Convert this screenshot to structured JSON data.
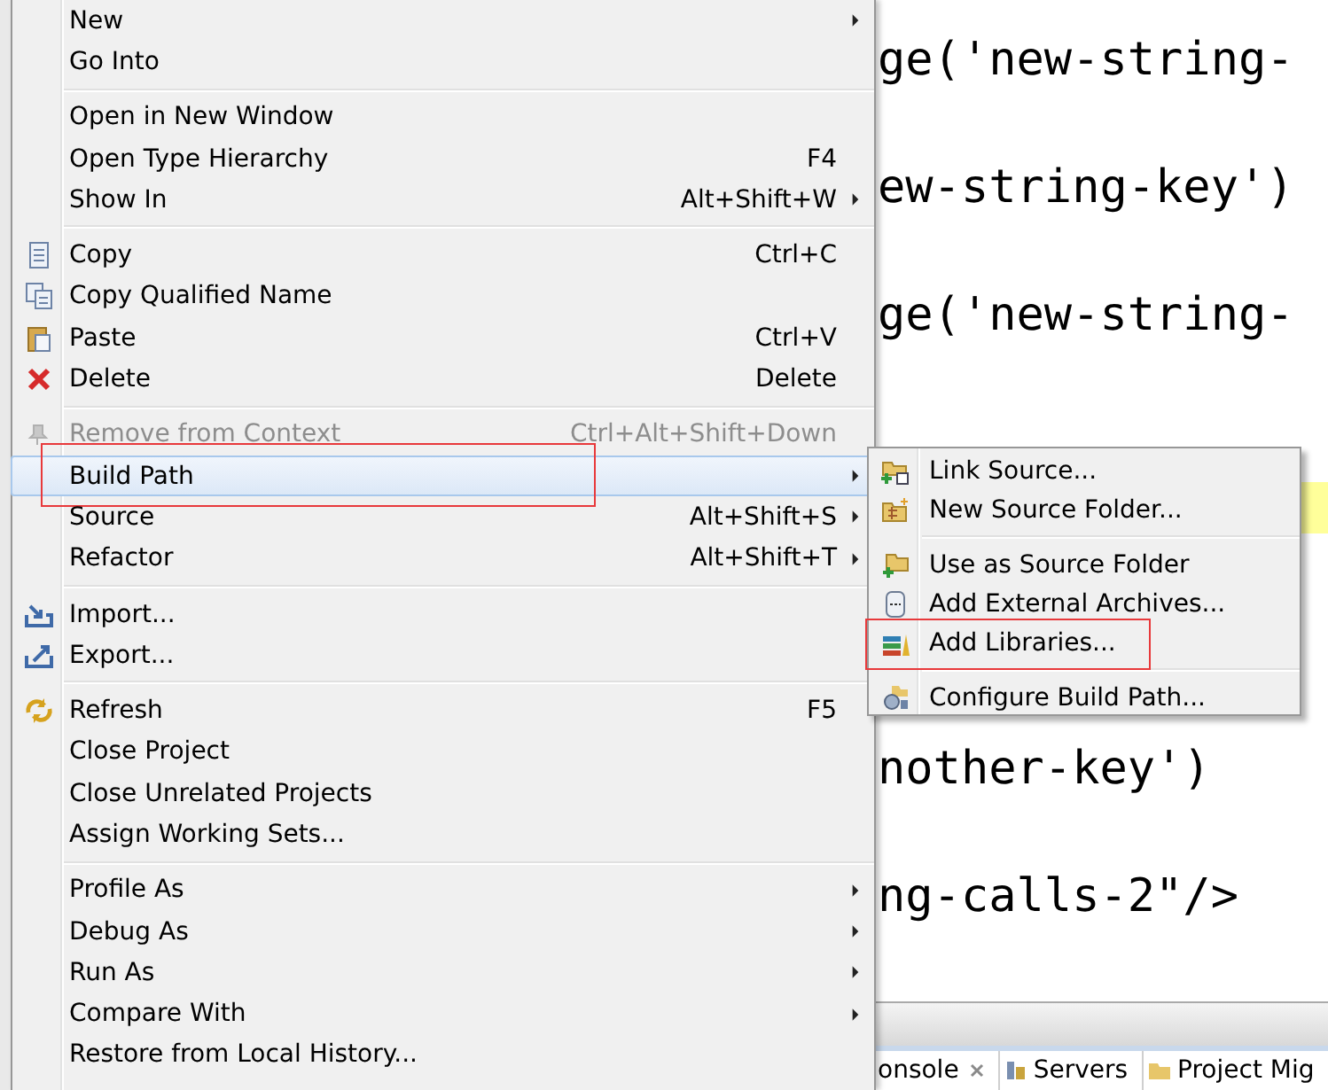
{
  "editor": {
    "code_lines": [
      {
        "text": "ge('new-string-"
      },
      {
        "text": "ew-string-key')"
      },
      {
        "text": "ge('new-string-"
      },
      {
        "text": "nother-key')"
      },
      {
        "text": "ng-calls-2\"/>"
      }
    ],
    "bottom_tabs": [
      {
        "label": "onsole",
        "closable": true
      },
      {
        "label": "Servers",
        "closable": false
      },
      {
        "label": "Project Mig",
        "closable": false
      }
    ]
  },
  "context_menu": {
    "groups": [
      [
        {
          "label": "New",
          "submenu": true,
          "disabled": false,
          "selected": false,
          "annotated": false
        },
        {
          "label": "Go Into",
          "submenu": false,
          "disabled": false,
          "selected": false,
          "annotated": false
        }
      ],
      [
        {
          "label": "Open in New Window",
          "submenu": false,
          "disabled": false,
          "selected": false,
          "annotated": false
        },
        {
          "label": "Open Type Hierarchy",
          "shortcut": "F4",
          "submenu": false,
          "disabled": false,
          "selected": false,
          "annotated": false
        },
        {
          "label": "Show In",
          "shortcut": "Alt+Shift+W",
          "submenu": true,
          "disabled": false,
          "selected": false,
          "annotated": false
        }
      ],
      [
        {
          "label": "Copy",
          "shortcut": "Ctrl+C",
          "submenu": false,
          "disabled": false,
          "selected": false,
          "annotated": false
        },
        {
          "label": "Copy Qualified Name",
          "submenu": false,
          "disabled": false,
          "selected": false,
          "annotated": false
        },
        {
          "label": "Paste",
          "shortcut": "Ctrl+V",
          "submenu": false,
          "disabled": false,
          "selected": false,
          "annotated": false
        },
        {
          "label": "Delete",
          "shortcut": "Delete",
          "submenu": false,
          "disabled": false,
          "selected": false,
          "annotated": false
        }
      ],
      [
        {
          "label": "Remove from Context",
          "shortcut": "Ctrl+Alt+Shift+Down",
          "submenu": false,
          "disabled": true,
          "selected": false,
          "annotated": false
        },
        {
          "label": "Build Path",
          "submenu": true,
          "disabled": false,
          "selected": true,
          "annotated": true
        },
        {
          "label": "Source",
          "shortcut": "Alt+Shift+S",
          "submenu": true,
          "disabled": false,
          "selected": false,
          "annotated": false
        },
        {
          "label": "Refactor",
          "shortcut": "Alt+Shift+T",
          "submenu": true,
          "disabled": false,
          "selected": false,
          "annotated": false
        }
      ],
      [
        {
          "label": "Import...",
          "submenu": false,
          "disabled": false,
          "selected": false,
          "annotated": false
        },
        {
          "label": "Export...",
          "submenu": false,
          "disabled": false,
          "selected": false,
          "annotated": false
        }
      ],
      [
        {
          "label": "Refresh",
          "shortcut": "F5",
          "submenu": false,
          "disabled": false,
          "selected": false,
          "annotated": false
        },
        {
          "label": "Close Project",
          "submenu": false,
          "disabled": false,
          "selected": false,
          "annotated": false
        },
        {
          "label": "Close Unrelated Projects",
          "submenu": false,
          "disabled": false,
          "selected": false,
          "annotated": false
        },
        {
          "label": "Assign Working Sets...",
          "submenu": false,
          "disabled": false,
          "selected": false,
          "annotated": false
        }
      ],
      [
        {
          "label": "Profile As",
          "submenu": true,
          "disabled": false,
          "selected": false,
          "annotated": false
        },
        {
          "label": "Debug As",
          "submenu": true,
          "disabled": false,
          "selected": false,
          "annotated": false
        },
        {
          "label": "Run As",
          "submenu": true,
          "disabled": false,
          "selected": false,
          "annotated": false
        },
        {
          "label": "Compare With",
          "submenu": true,
          "disabled": false,
          "selected": false,
          "annotated": false
        },
        {
          "label": "Restore from Local History...",
          "submenu": false,
          "disabled": false,
          "selected": false,
          "annotated": false
        }
      ]
    ]
  },
  "build_path_submenu": {
    "groups": [
      [
        {
          "label": "Link Source...",
          "annotated": false
        },
        {
          "label": "New Source Folder...",
          "annotated": false
        }
      ],
      [
        {
          "label": "Use as Source Folder",
          "annotated": false
        },
        {
          "label": "Add External Archives...",
          "annotated": false
        },
        {
          "label": "Add Libraries...",
          "annotated": true
        }
      ],
      [
        {
          "label": "Configure Build Path...",
          "annotated": false
        }
      ]
    ]
  }
}
